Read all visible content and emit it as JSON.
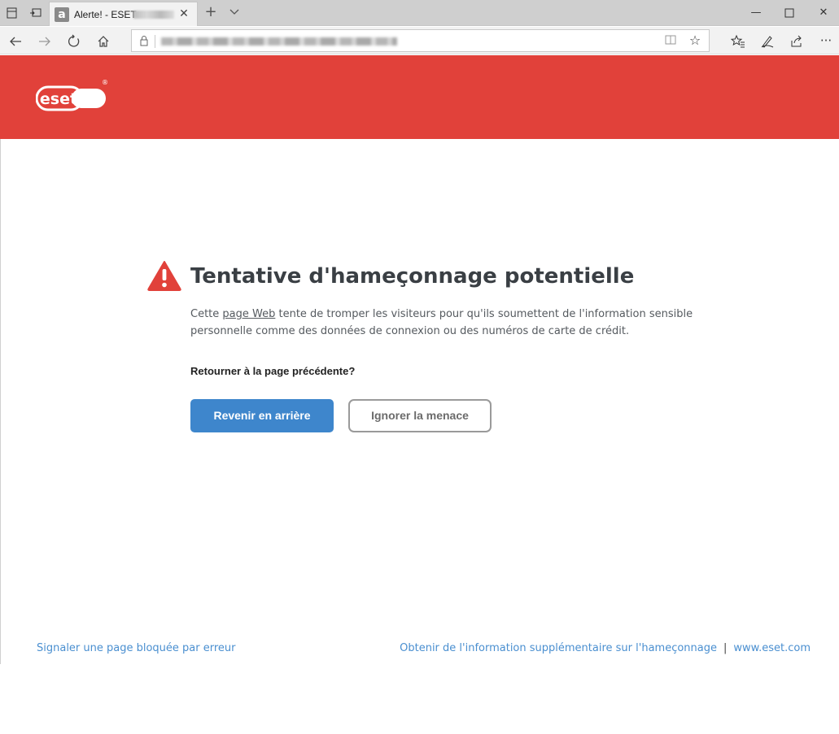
{
  "browser": {
    "tab_title": "Alerte! - ESET",
    "tab_favicon": "a",
    "icons": {
      "tab_aside": "tabs-aside-icon",
      "restore_tabs": "restore-tabs-icon",
      "close_tab": "close-icon",
      "new_tab": "plus-icon",
      "tab_list": "chevron-down-icon",
      "minimize": "minimize-icon",
      "maximize": "maximize-icon",
      "close_window": "close-icon",
      "back": "back-arrow-icon",
      "forward": "forward-arrow-icon",
      "refresh": "refresh-icon",
      "home": "home-icon",
      "lock": "lock-icon",
      "reading_view": "reading-view-icon",
      "favorite": "star-icon",
      "favorites_hub": "favorites-list-icon",
      "notes": "pen-icon",
      "share": "share-icon",
      "more": "more-icon"
    }
  },
  "brand": {
    "logo_text": "eset",
    "registered_mark": "®",
    "header_color": "#e1413a"
  },
  "alert": {
    "title": "Tentative d'hameçonnage potentielle",
    "desc_prefix": "Cette ",
    "desc_link": "page Web",
    "desc_suffix": " tente de tromper les visiteurs pour qu'ils soumettent de l'information sensible personnelle comme des données de connexion ou des numéros de carte de crédit.",
    "question": "Retourner à la page précédente?",
    "primary_button": "Revenir en arrière",
    "secondary_button": "Ignorer la menace",
    "warning_color": "#e1413a",
    "primary_color": "#3e86cc"
  },
  "footer": {
    "report_link": "Signaler une page bloquée par erreur",
    "info_link": "Obtenir de l'information supplémentaire sur l'hameçonnage",
    "separator": "|",
    "site_link": "www.eset.com",
    "link_color": "#4a8fd0"
  }
}
